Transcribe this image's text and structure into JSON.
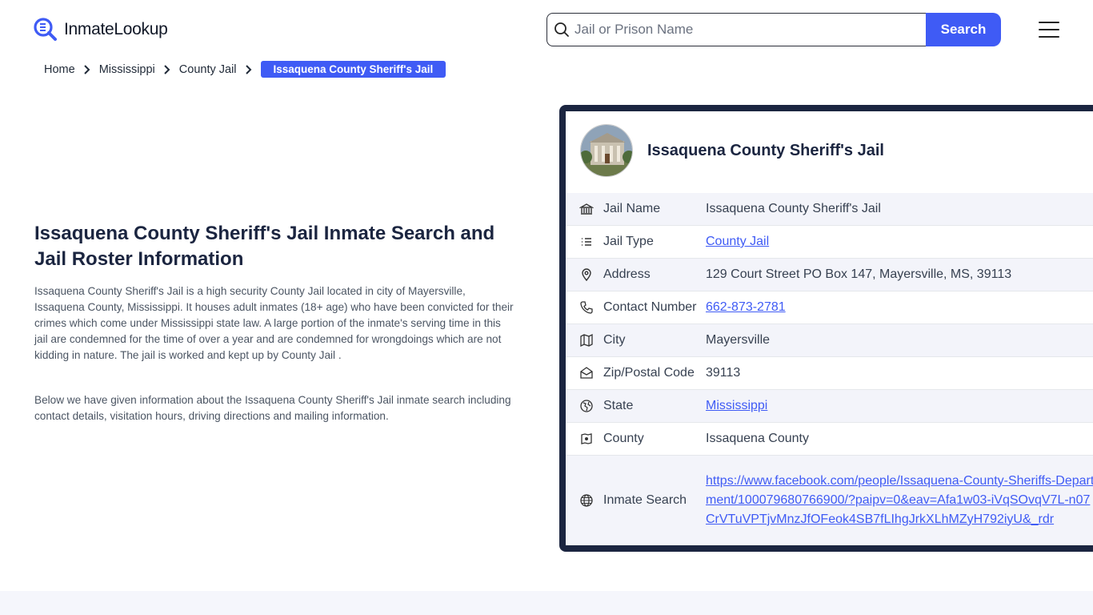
{
  "header": {
    "logo_text": "InmateLookup",
    "search_placeholder": "Jail or Prison Name",
    "search_button": "Search"
  },
  "breadcrumb": {
    "items": [
      "Home",
      "Mississippi",
      "County Jail"
    ],
    "current": "Issaquena County Sheriff's Jail"
  },
  "main": {
    "title": "Issaquena County Sheriff's Jail Inmate Search and Jail Roster Information",
    "paragraph1": "Issaquena County Sheriff's Jail is a high security County Jail located in city of Mayersville, Issaquena County, Mississippi. It houses adult inmates (18+ age) who have been convicted for their crimes which come under Mississippi state law. A large portion of the inmate's serving time in this jail are condemned for the time of over a year and are condemned for wrongdoings which are not kidding in nature. The jail is worked and kept up by County Jail .",
    "paragraph2": "Below we have given information about the Issaquena County Sheriff's Jail inmate search including contact details, visitation hours, driving directions and mailing information."
  },
  "card": {
    "title": "Issaquena County Sheriff's Jail",
    "rows": [
      {
        "icon": "building-icon",
        "label": "Jail Name",
        "value": "Issaquena County Sheriff's Jail"
      },
      {
        "icon": "list-icon",
        "label": "Jail Type",
        "value": "County Jail"
      },
      {
        "icon": "location-pin-icon",
        "label": "Address",
        "value": "129 Court Street PO Box 147, Mayersville, MS, 39113"
      },
      {
        "icon": "phone-icon",
        "label": "Contact Number",
        "value": "662-873-2781"
      },
      {
        "icon": "map-icon",
        "label": "City",
        "value": "Mayersville"
      },
      {
        "icon": "mail-icon",
        "label": "Zip/Postal Code",
        "value": "39113"
      },
      {
        "icon": "globe-region-icon",
        "label": "State",
        "value": "Mississippi"
      },
      {
        "icon": "county-icon",
        "label": "County",
        "value": "Issaquena County"
      },
      {
        "icon": "globe-icon",
        "label": "Inmate Search",
        "value": "https://www.facebook.com/people/Issaquena-County-Sheriffs-Department/100079680766900/?paipv=0&eav=Afa1w03-iVqSOvqV7L-n07CrVTuVPTjvMnzJfOFeok4SB7fLIhgJrkXLhMZyH792iyU&_rdr"
      }
    ]
  },
  "colors": {
    "accent": "#3f5bf5",
    "dark": "#1b2540",
    "row_alt": "#f3f4fa"
  }
}
